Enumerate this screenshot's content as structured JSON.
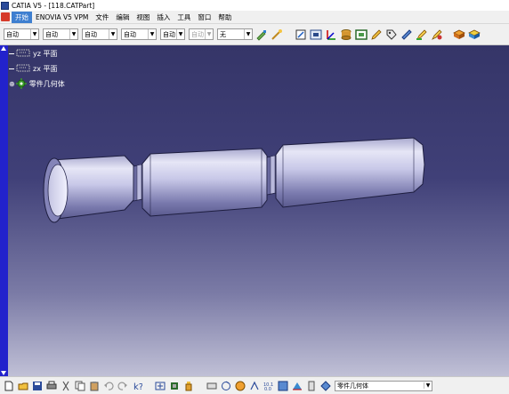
{
  "window": {
    "title": "CATIA V5 - [118.CATPart]"
  },
  "menu": [
    "开始",
    "ENOVIA V5 VPM",
    "文件",
    "编辑",
    "视图",
    "插入",
    "工具",
    "窗口",
    "帮助"
  ],
  "toolbar": {
    "combos": [
      {
        "value": "自动",
        "disabled": false
      },
      {
        "value": "自动",
        "disabled": false
      },
      {
        "value": "自动",
        "disabled": false
      },
      {
        "value": "自动",
        "disabled": false
      },
      {
        "value": "自动",
        "disabled": false
      },
      {
        "value": "自动",
        "disabled": true
      },
      {
        "value": "无",
        "disabled": false
      }
    ],
    "icons": [
      "paint-icon",
      "wand-icon",
      "sketch-icon",
      "view-icon",
      "axis-icon",
      "cylinder-icon",
      "image-icon",
      "pencil-icon",
      "tag-icon",
      "measure-icon",
      "edit-icon",
      "edit-icon",
      "catalog-icon",
      "cube-icon"
    ]
  },
  "tree": {
    "items": [
      {
        "label": "yz 平面",
        "icon": "plane-icon"
      },
      {
        "label": "zx 平面",
        "icon": "plane-icon"
      },
      {
        "label": "零件几何体",
        "icon": "gear-icon"
      }
    ]
  },
  "statusbar": {
    "icons": [
      "new-icon",
      "open-icon",
      "save-icon",
      "print-icon",
      "cut-icon",
      "copy-icon",
      "paste-icon",
      "undo-icon",
      "redo-icon",
      "help-icon",
      "fit-icon",
      "layers-icon",
      "bottle-icon",
      "cursor-icon",
      "rotate-icon",
      "pan-icon",
      "zoom-icon",
      "normal-view-icon",
      "multi-view-icon",
      "std-view-icon",
      "render-icon",
      "hide-icon"
    ],
    "body_select": "零件几何体"
  },
  "colors": {
    "accent": "#3e7fd0",
    "bg_top": "#353568",
    "bg_bottom": "#c0c0d6",
    "strip": "#2222cc"
  }
}
